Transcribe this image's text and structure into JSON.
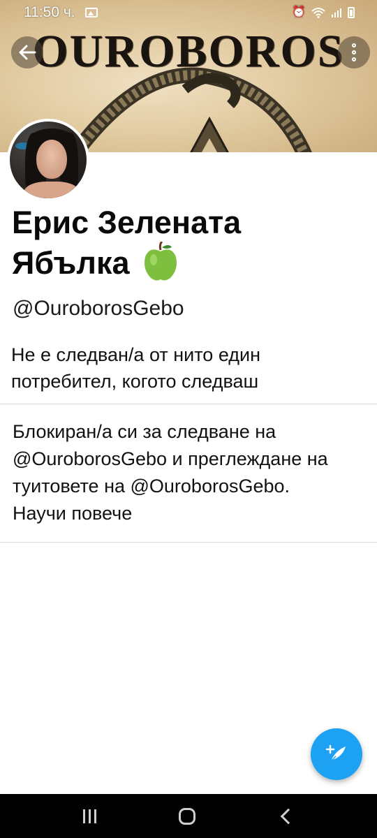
{
  "status_bar": {
    "time": "11:50 ч."
  },
  "banner": {
    "title": "OUROBOROS"
  },
  "profile": {
    "display_name": "Ерис Зелената Ябълка",
    "handle": "@OuroborosGebo",
    "follow_note": "Не е следван/а от нито един потребител, когото следваш"
  },
  "blocked": {
    "message": "Блокиран/а си за следване на @OuroborosGebo и преглеждане на туитовете на @OuroborosGebo.",
    "learn_more": "Научи повече"
  },
  "icons": {
    "back": "arrow-left-icon",
    "more": "more-vertical-icon",
    "compose": "compose-tweet-icon"
  },
  "colors": {
    "accent": "#1da1f2",
    "nav_bar": "#000000"
  }
}
